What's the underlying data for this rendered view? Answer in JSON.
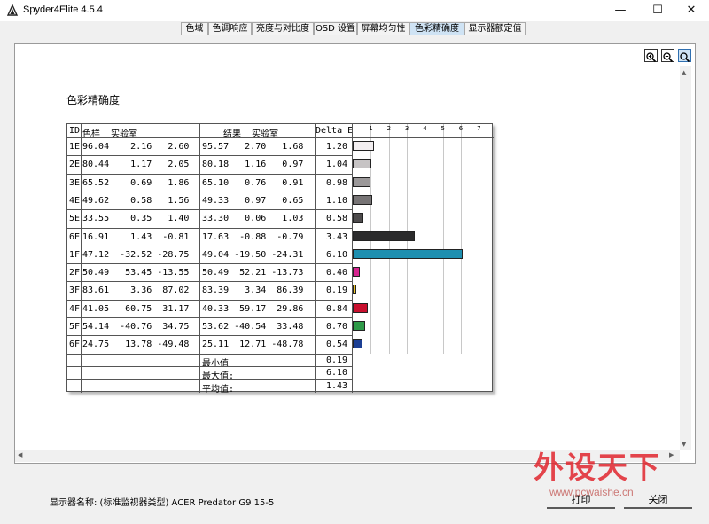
{
  "window": {
    "title": "Spyder4Elite 4.5.4",
    "minimize": "—",
    "maximize": "☐",
    "close": "✕"
  },
  "tabs": [
    {
      "label": "色域"
    },
    {
      "label": "色调响应"
    },
    {
      "label": "亮度与对比度"
    },
    {
      "label": "OSD 设置"
    },
    {
      "label": "屏幕均匀性"
    },
    {
      "label": "色彩精确度",
      "active": true
    },
    {
      "label": "显示器额定值"
    }
  ],
  "toolbar": {
    "zoom_in": "zoom-in",
    "zoom_out": "zoom-out",
    "zoom_fit": "zoom-fit"
  },
  "report": {
    "title": "色彩精确度",
    "headers": {
      "id": "ID",
      "sample": "色样  实验室",
      "result": "结果  实验室",
      "delta": "Delta E"
    },
    "ticks": [
      "1",
      "2",
      "3",
      "4",
      "5",
      "6",
      "7"
    ],
    "rows": [
      {
        "id": "1E",
        "s": "96.04    2.16   2.60",
        "r": "95.57   2.70   1.68",
        "d": "1.20",
        "v": 1.2,
        "color": "#f2eef0"
      },
      {
        "id": "2E",
        "s": "80.44    1.17   2.05",
        "r": "80.18   1.16   0.97",
        "d": "1.04",
        "v": 1.04,
        "color": "#c6c3c4"
      },
      {
        "id": "3E",
        "s": "65.52    0.69   1.86",
        "r": "65.10   0.76   0.91",
        "d": "0.98",
        "v": 0.98,
        "color": "#9b9899"
      },
      {
        "id": "4E",
        "s": "49.62    0.58   1.56",
        "r": "49.33   0.97   0.65",
        "r_": "",
        "d": "1.10",
        "v": 1.1,
        "color": "#777475"
      },
      {
        "id": "5E",
        "s": "33.55    0.35   1.40",
        "r": "33.30   0.06   1.03",
        "d": "0.58",
        "v": 0.58,
        "color": "#4d4b4c"
      },
      {
        "id": "6E",
        "s": "16.91    1.43  -0.81",
        "r": "17.63  -0.88  -0.79",
        "d": "3.43",
        "v": 3.43,
        "color": "#2b2b2c"
      },
      {
        "id": "1F",
        "s": "47.12  -32.52 -28.75",
        "r": "49.04 -19.50 -24.31",
        "d": "6.10",
        "v": 6.1,
        "color": "#1e8fb0"
      },
      {
        "id": "2F",
        "s": "50.49   53.45 -13.55",
        "r": "50.49  52.21 -13.73",
        "d": "0.40",
        "v": 0.4,
        "color": "#d6238f"
      },
      {
        "id": "3F",
        "s": "83.61    3.36  87.02",
        "r": "83.39   3.34  86.39",
        "d": "0.19",
        "v": 0.19,
        "color": "#f0c826"
      },
      {
        "id": "4F",
        "s": "41.05   60.75  31.17",
        "r": "40.33  59.17  29.86",
        "d": "0.84",
        "v": 0.84,
        "color": "#c8102e"
      },
      {
        "id": "5F",
        "s": "54.14  -40.76  34.75",
        "r": "53.62 -40.54  33.48",
        "d": "0.70",
        "v": 0.7,
        "color": "#2e9a48"
      },
      {
        "id": "6F",
        "s": "24.75   13.78 -49.48",
        "r": "25.11  12.71 -48.78",
        "d": "0.54",
        "v": 0.54,
        "color": "#1c3f94"
      }
    ],
    "summary": [
      {
        "label": "最小值",
        "value": "0.19"
      },
      {
        "label": "最大值:",
        "value": "6.10"
      },
      {
        "label": "平均值:",
        "value": "1.43"
      }
    ]
  },
  "footer": {
    "monitor_label": "显示器名称: (标准监视器类型) ACER Predator G9 15-5",
    "print": "打印",
    "close": "关闭"
  },
  "watermark": {
    "main": "外设天下",
    "url": "www.pcwaishe.cn"
  }
}
